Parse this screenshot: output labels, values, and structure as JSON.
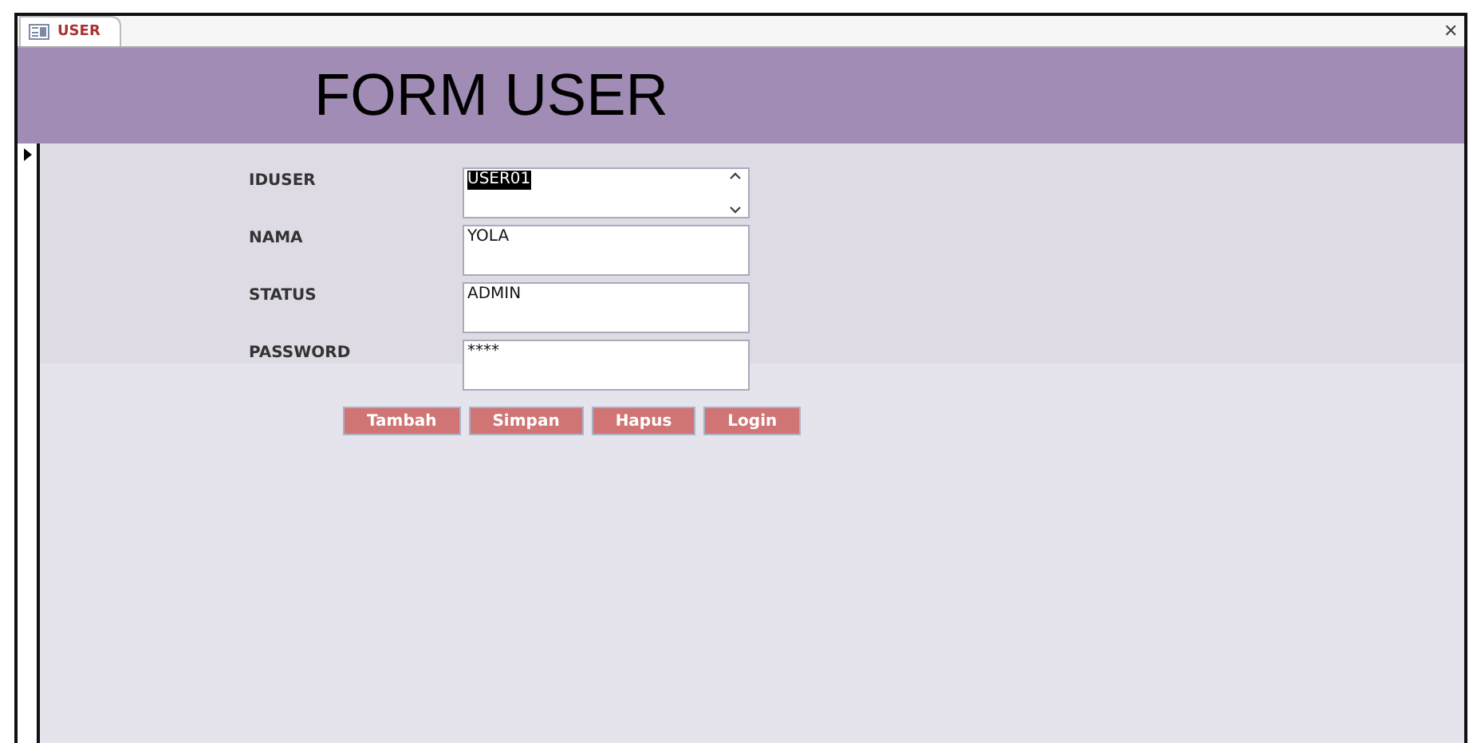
{
  "tab": {
    "label": "USER",
    "selected": true
  },
  "close_button": "✕",
  "header": {
    "title": "FORM USER"
  },
  "record_selector": {
    "current": true
  },
  "fields": [
    {
      "label": "IDUSER",
      "value": "USER01",
      "highlighted": true,
      "scrollbar": true
    },
    {
      "label": "NAMA",
      "value": "YOLA",
      "highlighted": false,
      "scrollbar": false
    },
    {
      "label": "STATUS",
      "value": "ADMIN",
      "highlighted": false,
      "scrollbar": false
    },
    {
      "label": "PASSWORD",
      "value": "****",
      "highlighted": false,
      "scrollbar": false
    }
  ],
  "buttons": [
    "Tambah",
    "Simpan",
    "Hapus",
    "Login"
  ]
}
